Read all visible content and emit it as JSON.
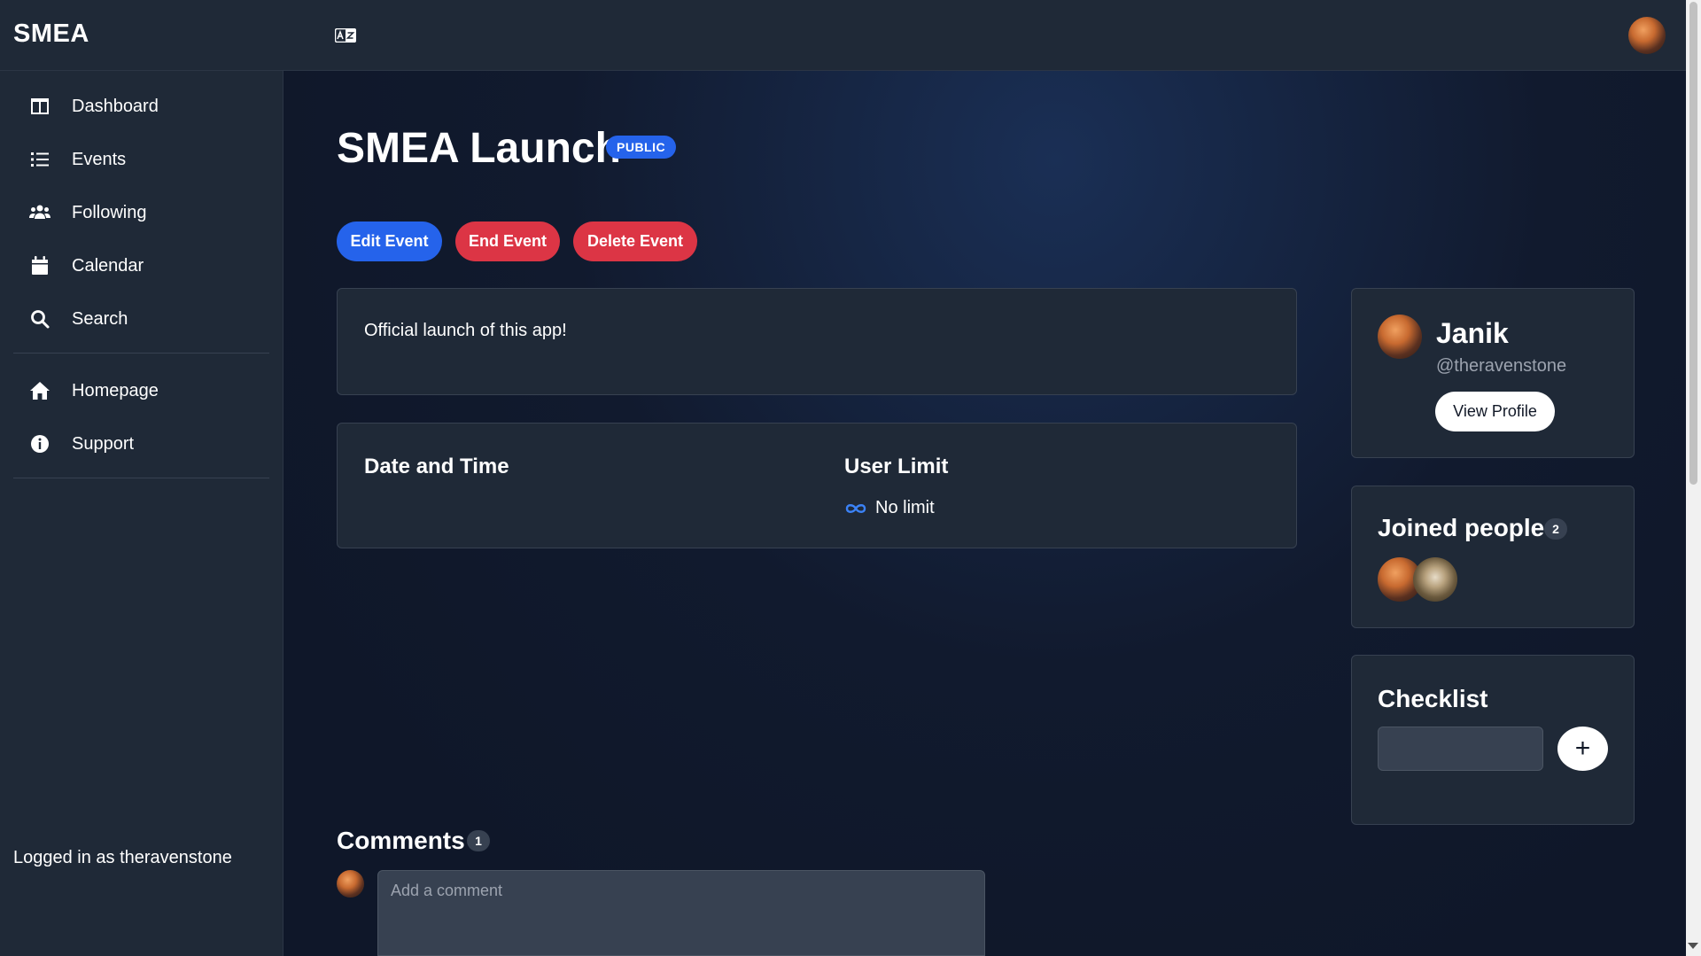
{
  "app": {
    "brand": "SMEA"
  },
  "sidebar": {
    "items": [
      {
        "label": "Dashboard",
        "icon": "dashboard-icon"
      },
      {
        "label": "Events",
        "icon": "list-icon"
      },
      {
        "label": "Following",
        "icon": "users-icon"
      },
      {
        "label": "Calendar",
        "icon": "calendar-icon"
      },
      {
        "label": "Search",
        "icon": "search-icon"
      }
    ],
    "secondary": [
      {
        "label": "Homepage",
        "icon": "home-icon"
      },
      {
        "label": "Support",
        "icon": "info-icon"
      }
    ],
    "logged_in": "Logged in as theravenstone"
  },
  "event": {
    "title": "SMEA Launch",
    "visibility": "PUBLIC",
    "actions": {
      "edit": "Edit Event",
      "end": "End Event",
      "delete": "Delete Event"
    },
    "description": "Official launch of this app!",
    "date_heading": "Date and Time",
    "limit_heading": "User Limit",
    "limit_value": "No limit"
  },
  "organizer": {
    "name": "Janik",
    "handle": "@theravenstone",
    "view_profile": "View Profile"
  },
  "joined": {
    "title": "Joined people",
    "count": "2"
  },
  "checklist": {
    "title": "Checklist",
    "add_symbol": "+"
  },
  "comments": {
    "title": "Comments",
    "count": "1",
    "placeholder": "Add a comment"
  },
  "colors": {
    "accent": "#2563eb",
    "danger": "#dc3545",
    "panel": "#1f2937",
    "background": "#0f1729"
  }
}
